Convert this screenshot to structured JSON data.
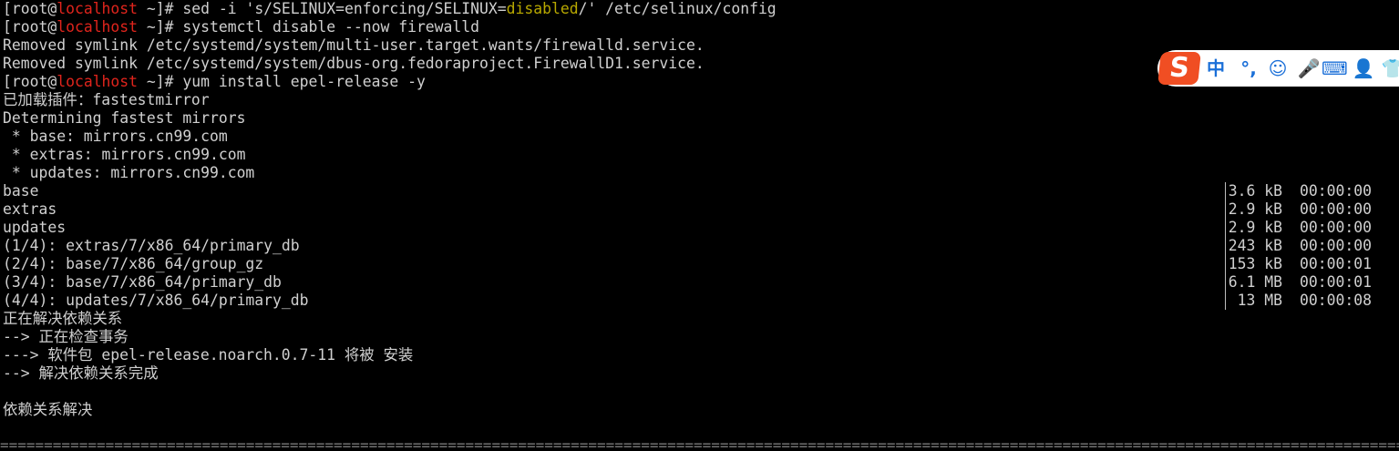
{
  "prompt": {
    "user_host_prefix": "[root@",
    "host": "localhost",
    "suffix": " ~]# "
  },
  "commands": {
    "sed_pre": "sed -i 's/SELINUX=enforcing/SELINUX=",
    "sed_val": "disabled",
    "sed_post": "/' /etc/selinux/config",
    "systemctl": "systemctl disable --now firewalld",
    "yum": "yum install epel-release -y"
  },
  "output": {
    "removed1": "Removed symlink /etc/systemd/system/multi-user.target.wants/firewalld.service.",
    "removed2": "Removed symlink /etc/systemd/system/dbus-org.fedoraproject.FirewallD1.service.",
    "plugins": "已加载插件：fastestmirror",
    "determining": "Determining fastest mirrors",
    "m_base": " * base: mirrors.cn99.com",
    "m_extras": " * extras: mirrors.cn99.com",
    "m_updates": " * updates: mirrors.cn99.com",
    "resolving": "正在解决依赖关系",
    "checking": "--> 正在检查事务",
    "package": "---> 软件包 epel-release.noarch.0.7-11 将被 安装",
    "resolved_done": "--> 解决依赖关系完成",
    "deps_resolved": "依赖关系解决"
  },
  "repos": [
    {
      "name": "base",
      "size": "3.6 kB",
      "time": "00:00:00"
    },
    {
      "name": "extras",
      "size": "2.9 kB",
      "time": "00:00:00"
    },
    {
      "name": "updates",
      "size": "2.9 kB",
      "time": "00:00:00"
    },
    {
      "name": "(1/4): extras/7/x86_64/primary_db",
      "size": "243 kB",
      "time": "00:00:00"
    },
    {
      "name": "(2/4): base/7/x86_64/group_gz",
      "size": "153 kB",
      "time": "00:00:01"
    },
    {
      "name": "(3/4): base/7/x86_64/primary_db",
      "size": "6.1 MB",
      "time": "00:00:01"
    },
    {
      "name": "(4/4): updates/7/x86_64/primary_db",
      "size": "13 MB",
      "time": "00:00:08"
    }
  ],
  "separator": "=================================================================================================================================================================================================================",
  "ime": {
    "logo": "S",
    "items": [
      {
        "label": "中",
        "icon": "chinese-mode-icon"
      },
      {
        "label": "°,",
        "icon": "punctuation-icon"
      },
      {
        "label": "☺",
        "icon": "emoji-icon"
      },
      {
        "label": "🎤",
        "icon": "microphone-icon"
      },
      {
        "label": "⌨",
        "icon": "keyboard-icon"
      },
      {
        "label": "👤",
        "icon": "user-icon"
      },
      {
        "label": "👕",
        "icon": "skin-icon"
      }
    ]
  }
}
